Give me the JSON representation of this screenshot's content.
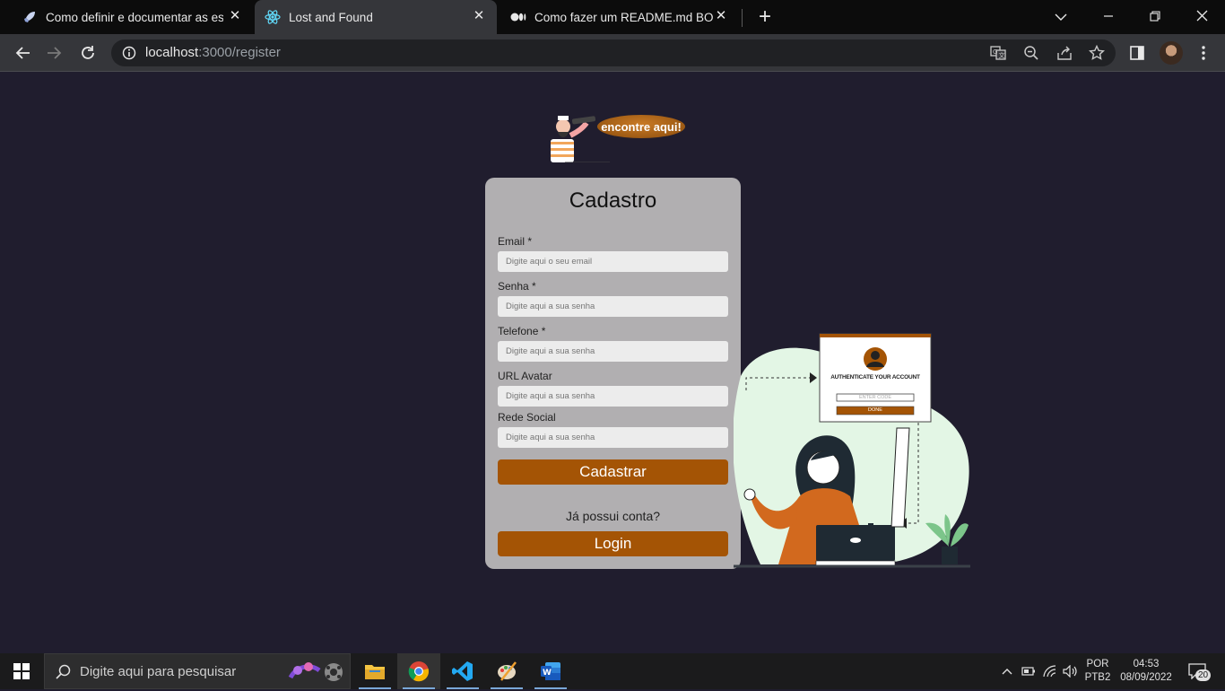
{
  "browser": {
    "tabs": [
      {
        "title": "Como definir e documentar as espe",
        "icon": "rocket-icon",
        "active": false
      },
      {
        "title": "Lost and Found",
        "icon": "react-icon",
        "active": true
      },
      {
        "title": "Como fazer um README.md BONIT/",
        "icon": "medium-icon",
        "active": false
      }
    ],
    "url_host": "localhost",
    "url_path": ":3000/register"
  },
  "page": {
    "logo_text": "encontre aqui!",
    "form": {
      "title": "Cadastro",
      "fields": [
        {
          "label": "Email *",
          "placeholder": "Digite aqui o seu email"
        },
        {
          "label": "Senha *",
          "placeholder": "Digite aqui a sua senha"
        },
        {
          "label": "Telefone *",
          "placeholder": "Digite aqui a sua senha"
        },
        {
          "label": "URL Avatar",
          "placeholder": "Digite aqui a sua senha"
        },
        {
          "label": "Rede Social",
          "placeholder": "Digite aqui a sua senha"
        }
      ],
      "submit_label": "Cadastrar",
      "have_account": "Já possui conta?",
      "login_label": "Login"
    },
    "illustration": {
      "card_title": "AUTHENTICATE YOUR ACCOUNT",
      "code_placeholder": "ENTER CODE",
      "done_label": "DONE"
    }
  },
  "taskbar": {
    "search_placeholder": "Digite aqui para pesquisar",
    "lang_top": "POR",
    "lang_bottom": "PTB2",
    "time": "04:53",
    "date": "08/09/2022",
    "notifications": "20"
  },
  "colors": {
    "background": "#201d2e",
    "card": "#b1afb1",
    "accent": "#a45405"
  }
}
